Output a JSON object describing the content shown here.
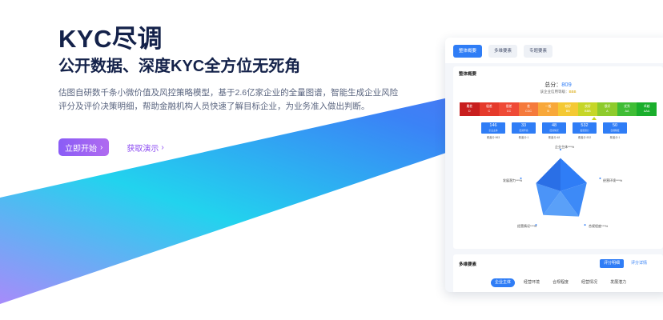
{
  "hero": {
    "title": "KYC尽调",
    "subtitle": "公开数据、深度KYC全方位无死角",
    "description": "估图自研数千条小微价值及风控策略模型，基于2.6亿家企业的全量图谱，智能生成企业风险评分及评价决策明细，帮助金融机构人员快速了解目标企业，为业务准入做出判断。",
    "start_button": "立即开始",
    "demo_link": "获取演示"
  },
  "card": {
    "tabs": [
      "整体概要",
      "多维要素",
      "专题要素"
    ],
    "active_tab": 0,
    "overview_title": "整体概要",
    "score_label": "总分：",
    "score_value": "809",
    "grade_label": "该企业信用等级：",
    "grade_value": "BBB",
    "scale": [
      {
        "name": "最差",
        "grade": "D",
        "color": "#c81e1e"
      },
      {
        "name": "极差",
        "grade": "C",
        "color": "#e53a2b"
      },
      {
        "name": "很差",
        "grade": "CC",
        "color": "#ef4a36"
      },
      {
        "name": "差",
        "grade": "CCC",
        "color": "#f57a3c"
      },
      {
        "name": "一般",
        "grade": "B",
        "color": "#f8a83a"
      },
      {
        "name": "较好",
        "grade": "BB",
        "color": "#f4c934"
      },
      {
        "name": "良好",
        "grade": "BBB",
        "color": "#c6d628"
      },
      {
        "name": "很好",
        "grade": "A",
        "color": "#8ecb2c"
      },
      {
        "name": "优秀",
        "grade": "AA",
        "color": "#3fbd35"
      },
      {
        "name": "卓越",
        "grade": "AAA",
        "color": "#1aae2c"
      }
    ],
    "stats": [
      {
        "value": "146",
        "label": "企业主体",
        "sub": "覆盖分:963"
      },
      {
        "value": "33",
        "label": "经营环境",
        "sub": "覆盖分:1"
      },
      {
        "value": "48",
        "label": "经营情况",
        "sub": "覆盖分:48"
      },
      {
        "value": "532",
        "label": "发展潜力",
        "sub": "覆盖分:532"
      },
      {
        "value": "50",
        "label": "合规程度",
        "sub": "覆盖分:1"
      }
    ],
    "radar": {
      "labels": [
        "企业主体***%",
        "经营环境***%",
        "合规程度***%",
        "经营情况***%",
        "发展潜力***%"
      ],
      "values": [
        0.9,
        0.75,
        0.85,
        0.8,
        0.7
      ]
    },
    "multi_title": "多维要素",
    "multi_btn_primary": "评分明细",
    "multi_btn_secondary": "评分详情",
    "dimensions": [
      "企业主体",
      "经营环境",
      "合规程度",
      "经营情况",
      "发展潜力"
    ],
    "active_dimension": 0
  },
  "colors": {
    "accent": "#2f7df6",
    "cta": "#8a5cf6"
  }
}
